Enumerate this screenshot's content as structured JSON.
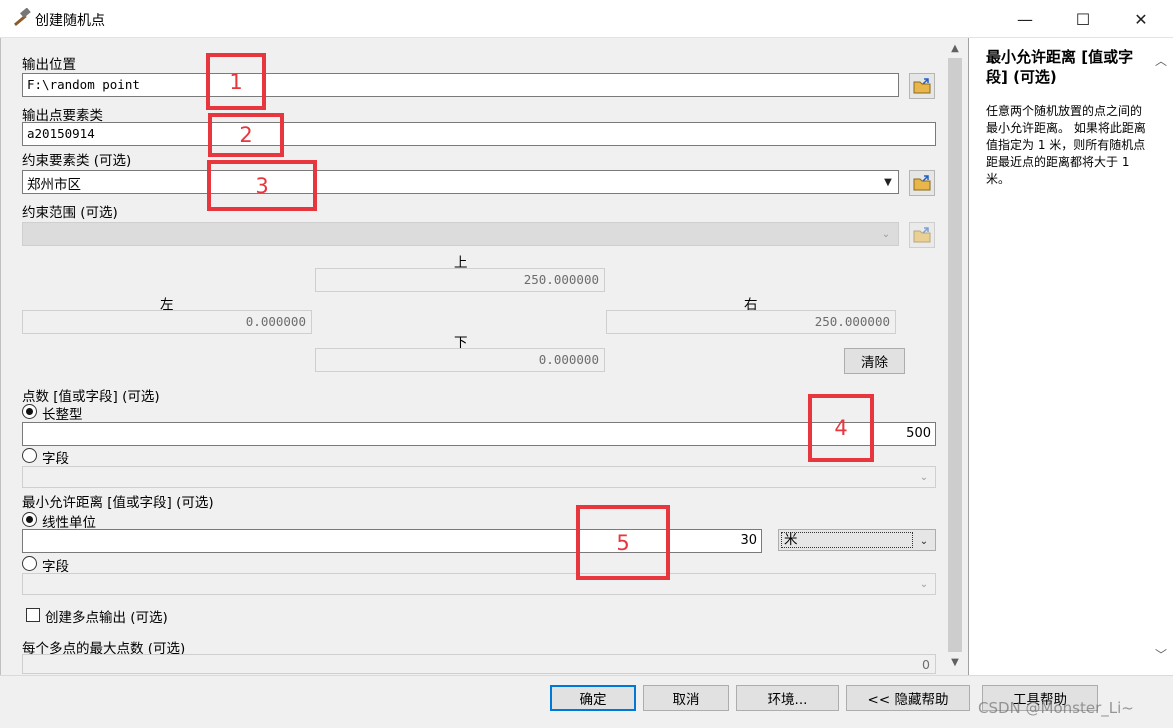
{
  "window": {
    "title": "创建随机点",
    "icons": {
      "app": "hammer-icon",
      "minimize": "minimize-icon",
      "maximize": "maximize-icon",
      "close": "close-icon"
    },
    "min_glyph": "—",
    "max_glyph": "☐",
    "close_glyph": "✕"
  },
  "form": {
    "output_location": {
      "label": "输出位置",
      "value": "F:\\random point"
    },
    "output_feature_class": {
      "label": "输出点要素类",
      "value": "a20150914"
    },
    "constraint_feature_class": {
      "label": "约束要素类 (可选)",
      "value": "郑州市区"
    },
    "constraint_extent": {
      "label": "约束范围 (可选)",
      "top_label": "上",
      "top": "250.000000",
      "left_label": "左",
      "left": "0.000000",
      "right_label": "右",
      "right": "250.000000",
      "bottom_label": "下",
      "bottom": "0.000000",
      "clear_label": "清除"
    },
    "number_of_points": {
      "label": "点数 [值或字段] (可选)",
      "option_long": "长整型",
      "long_value": "500",
      "option_field": "字段",
      "selected": "long"
    },
    "min_distance": {
      "label": "最小允许距离 [值或字段] (可选)",
      "option_linear": "线性单位",
      "linear_value": "30",
      "unit": "米",
      "option_field": "字段",
      "selected": "linear"
    },
    "create_multipoint": {
      "label": "创建多点输出 (可选)",
      "checked": false
    },
    "max_points_per_multipoint": {
      "label": "每个多点的最大点数 (可选)",
      "value": "0"
    }
  },
  "annotations": [
    "1",
    "2",
    "3",
    "4",
    "5"
  ],
  "annotation_color": "#e8363e",
  "help": {
    "title": "最小允许距离 [值或字段] (可选)",
    "body": "任意两个随机放置的点之间的最小允许距离。 如果将此距离值指定为 1 米，则所有随机点距最近点的距离都将大于 1 米。"
  },
  "buttons": {
    "ok": "确定",
    "cancel": "取消",
    "environments": "环境...",
    "hide_help": "<< 隐藏帮助",
    "tool_help": "工具帮助"
  },
  "watermark": "CSDN @Monster_Li~",
  "colors": {
    "primary_border": "#0078d7",
    "background": "#f0f0f0"
  }
}
